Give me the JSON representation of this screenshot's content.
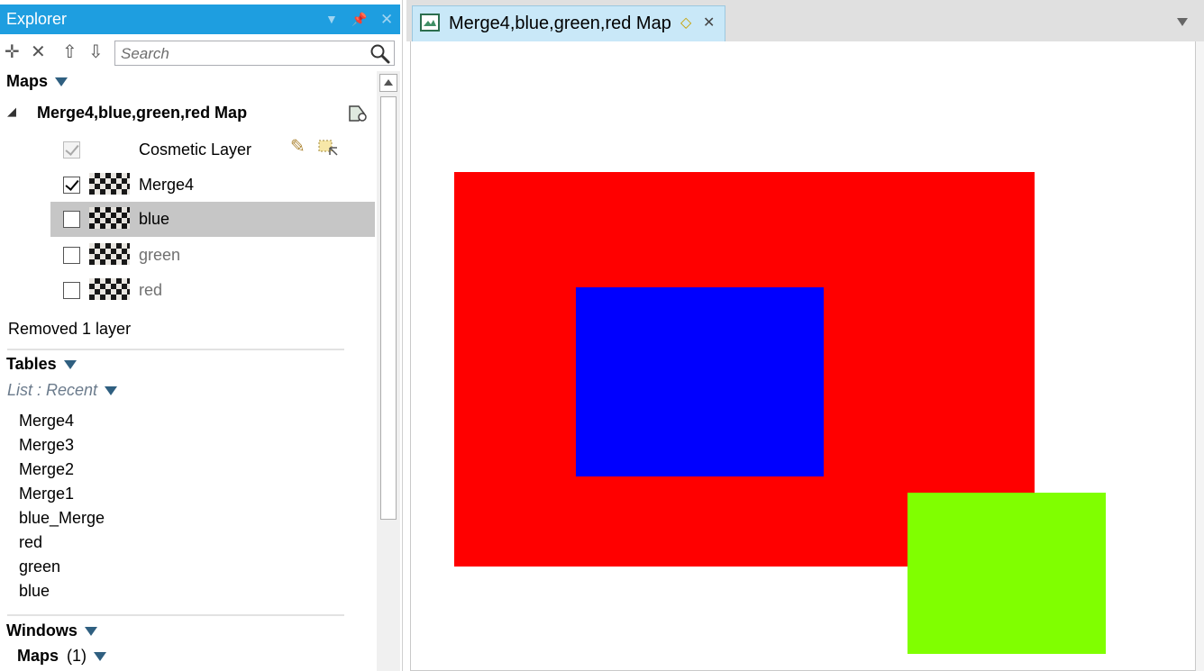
{
  "explorer": {
    "title": "Explorer",
    "search": {
      "placeholder": "Search",
      "value": ""
    },
    "maps_header": "Maps",
    "map": {
      "name": "Merge4,blue,green,red Map",
      "layers": [
        {
          "name": "Cosmetic Layer",
          "checked": true,
          "state": "disabled"
        },
        {
          "name": "Merge4",
          "checked": true,
          "state": "normal"
        },
        {
          "name": "blue",
          "checked": false,
          "state": "selected"
        },
        {
          "name": "green",
          "checked": false,
          "state": "dim"
        },
        {
          "name": "red",
          "checked": false,
          "state": "dim"
        }
      ]
    },
    "status": "Removed 1 layer",
    "tables_header": "Tables",
    "list_filter": "List : Recent",
    "tables": [
      "Merge4",
      "Merge3",
      "Merge2",
      "Merge1",
      "blue_Merge",
      "red",
      "green",
      "blue"
    ],
    "windows_header": "Windows",
    "windows_maps_label": "Maps",
    "windows_maps_count": "(1)"
  },
  "document": {
    "tab_title": "Merge4,blue,green,red Map",
    "map_colors": {
      "red": "#ff0000",
      "blue": "#0000ff",
      "green": "#80ff00"
    }
  },
  "colors": {
    "accent": "#1e9ee0",
    "tab_active": "#c9e8f8",
    "selection": "#c6c6c6"
  }
}
